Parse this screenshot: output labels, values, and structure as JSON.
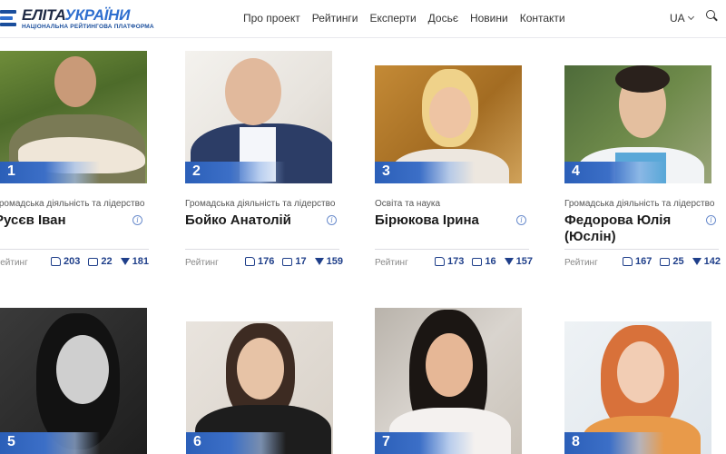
{
  "header": {
    "logo_title_a": "ЕЛІТА",
    "logo_title_b": "УКРАЇНИ",
    "logo_subtitle": "НАЦІОНАЛЬНА РЕЙТИНГОВА ПЛАТФОРМА",
    "nav": [
      "Про проект",
      "Рейтинги",
      "Експерти",
      "Досьє",
      "Новини",
      "Контакти"
    ],
    "lang": "UA"
  },
  "rating_label": "Рейтинг",
  "cards": [
    {
      "num": "1",
      "category": "Громадська діяльність та лідерство",
      "name": "Русєв Іван",
      "likes": "203",
      "comments": "22",
      "down": "181"
    },
    {
      "num": "2",
      "category": "Громадська діяльність та лідерство",
      "name": "Бойко Анатолій",
      "likes": "176",
      "comments": "17",
      "down": "159"
    },
    {
      "num": "3",
      "category": "Освіта та наука",
      "name": "Бірюкова Ірина",
      "likes": "173",
      "comments": "16",
      "down": "157"
    },
    {
      "num": "4",
      "category": "Громадська діяльність та лідерство",
      "name": "Федорова Юлія (Юслін)",
      "likes": "167",
      "comments": "25",
      "down": "142"
    },
    {
      "num": "5"
    },
    {
      "num": "6"
    },
    {
      "num": "7"
    },
    {
      "num": "8"
    }
  ],
  "colors": {
    "accent": "#2b5fb8",
    "stat": "#1f3f8a"
  }
}
